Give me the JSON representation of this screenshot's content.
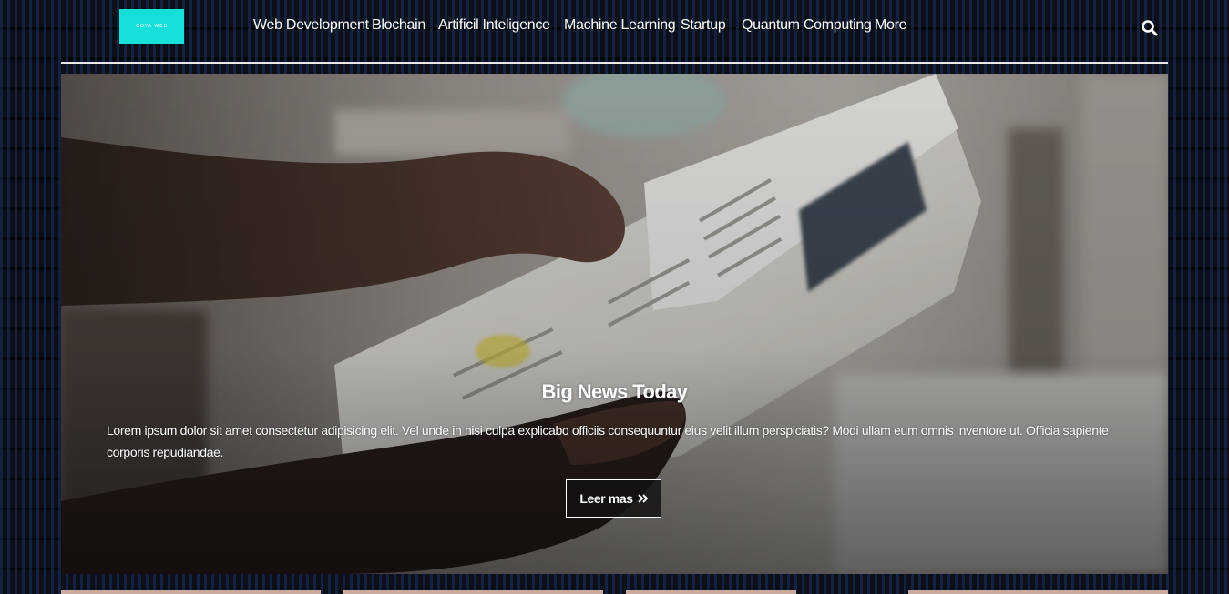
{
  "brand": {
    "logo_text": "GOYA WEB",
    "logo_color": "#17e0db"
  },
  "nav": {
    "items": [
      {
        "label": "Web Development"
      },
      {
        "label": "Blochain"
      },
      {
        "label": "Artificil Inteligence"
      },
      {
        "label": "Machine Learning"
      },
      {
        "label": "Startup"
      },
      {
        "label": "Quantum Computing"
      },
      {
        "label": "More"
      }
    ],
    "search_icon": "search-icon"
  },
  "hero": {
    "title": "Big News Today",
    "text": "Lorem ipsum dolor sit amet consectetur adipisicing elit. Vel unde in nisi culpa explicabo officiis consequuntur eius velit illum perspiciatis? Modi ullam eum omnis inventore ut. Officia sapiente corporis repudiandae.",
    "button_label": "Leer mas",
    "button_icon": "double-chevron-right-icon"
  },
  "colors": {
    "background": "#0a0f1a",
    "accent": "#17e0db",
    "text": "#ffffff"
  }
}
